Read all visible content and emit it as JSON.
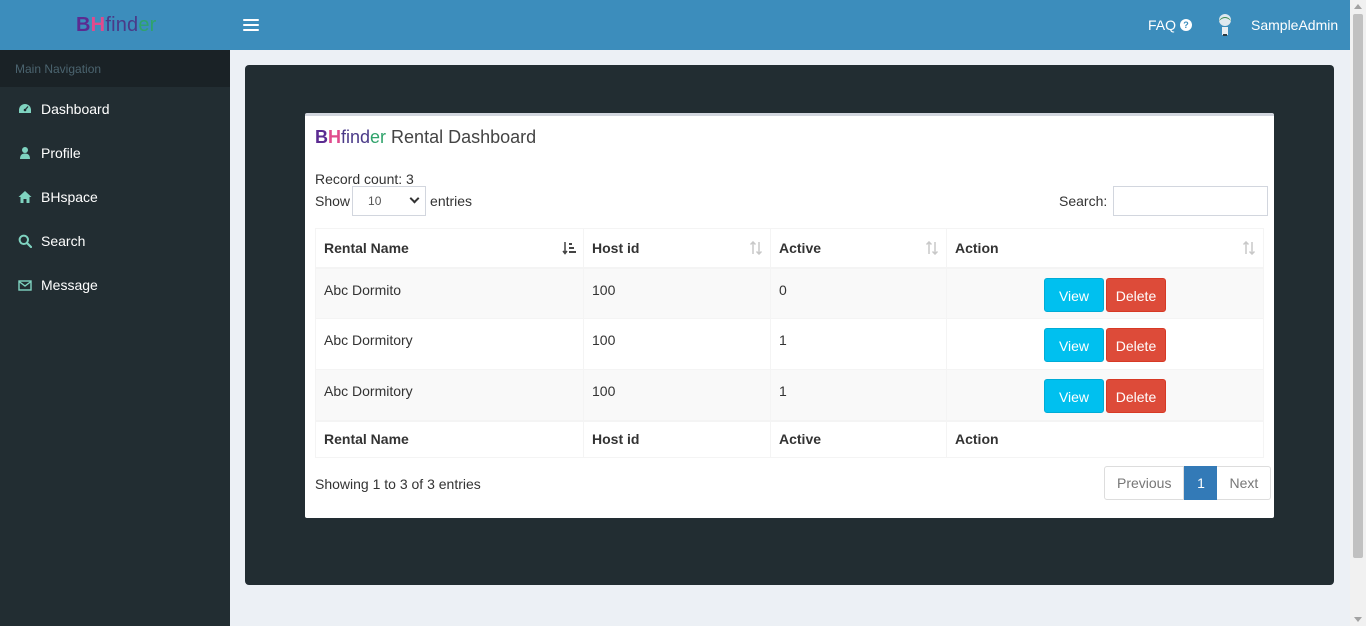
{
  "header": {
    "logo": {
      "b": "B",
      "h": "H",
      "find": "find",
      "er": "er"
    },
    "faq_label": "FAQ",
    "user_name": "SampleAdmin"
  },
  "sidebar": {
    "heading": "Main Navigation",
    "items": [
      {
        "label": "Dashboard",
        "icon": "dashboard-icon"
      },
      {
        "label": "Profile",
        "icon": "user-icon"
      },
      {
        "label": "BHspace",
        "icon": "home-icon"
      },
      {
        "label": "Search",
        "icon": "search-icon"
      },
      {
        "label": "Message",
        "icon": "envelope-icon"
      }
    ]
  },
  "main": {
    "title_rest": " Rental Dashboard",
    "record_count": "Record count: 3",
    "show_label": "Show",
    "entries_select": "10",
    "entries_label": "entries",
    "search_label": "Search:",
    "search_value": "",
    "columns": [
      "Rental Name",
      "Host id",
      "Active",
      "Action"
    ],
    "rows": [
      {
        "rental_name": "Abc Dormito",
        "host_id": "100",
        "active": "0"
      },
      {
        "rental_name": "Abc Dormitory",
        "host_id": "100",
        "active": "1"
      },
      {
        "rental_name": "Abc Dormitory",
        "host_id": "100",
        "active": "1"
      }
    ],
    "view_label": "View",
    "delete_label": "Delete",
    "info": "Showing 1 to 3 of 3 entries",
    "pagination": {
      "previous": "Previous",
      "current": "1",
      "next": "Next"
    }
  },
  "colors": {
    "header_bg": "#3c8dbc",
    "sidebar_bg": "#222d32",
    "view_button": "#00c0ef",
    "delete_button": "#dd4b39",
    "page_active": "#337ab7"
  }
}
